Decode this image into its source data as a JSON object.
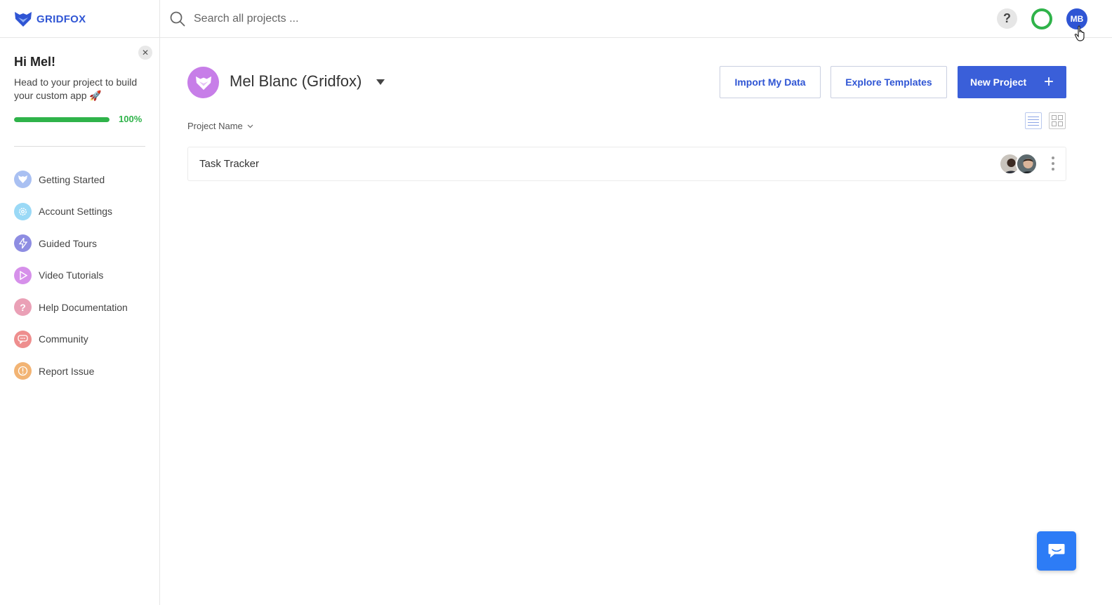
{
  "app": {
    "logo_text": "GRIDFOX",
    "brand_color": "#2f55d4"
  },
  "search": {
    "placeholder": "Search all projects ..."
  },
  "header": {
    "help_label": "?",
    "user_initials": "MB"
  },
  "sidebar": {
    "greeting": "Hi Mel!",
    "message": "Head to your project to build your custom app 🚀",
    "progress": {
      "value": 100,
      "label": "100%"
    },
    "items": [
      {
        "label": "Getting Started",
        "icon": "fox-icon",
        "color": "#9fb8f0"
      },
      {
        "label": "Account Settings",
        "icon": "gear-icon",
        "color": "#8fd3f4"
      },
      {
        "label": "Guided Tours",
        "icon": "lightning-icon",
        "color": "#8b8be0"
      },
      {
        "label": "Video Tutorials",
        "icon": "play-icon",
        "color": "#d48ae8"
      },
      {
        "label": "Help Documentation",
        "icon": "question-icon",
        "color": "#e89ab0"
      },
      {
        "label": "Community",
        "icon": "chat-icon",
        "color": "#ec8a8a"
      },
      {
        "label": "Report Issue",
        "icon": "alert-icon",
        "color": "#f0b070"
      }
    ]
  },
  "workspace": {
    "name": "Mel Blanc (Gridfox)"
  },
  "actions": {
    "import": "Import My Data",
    "templates": "Explore Templates",
    "new_project": "New Project",
    "new_project_icon": "+"
  },
  "list": {
    "sort_label": "Project Name",
    "projects": [
      {
        "name": "Task Tracker",
        "members": 2
      }
    ]
  }
}
